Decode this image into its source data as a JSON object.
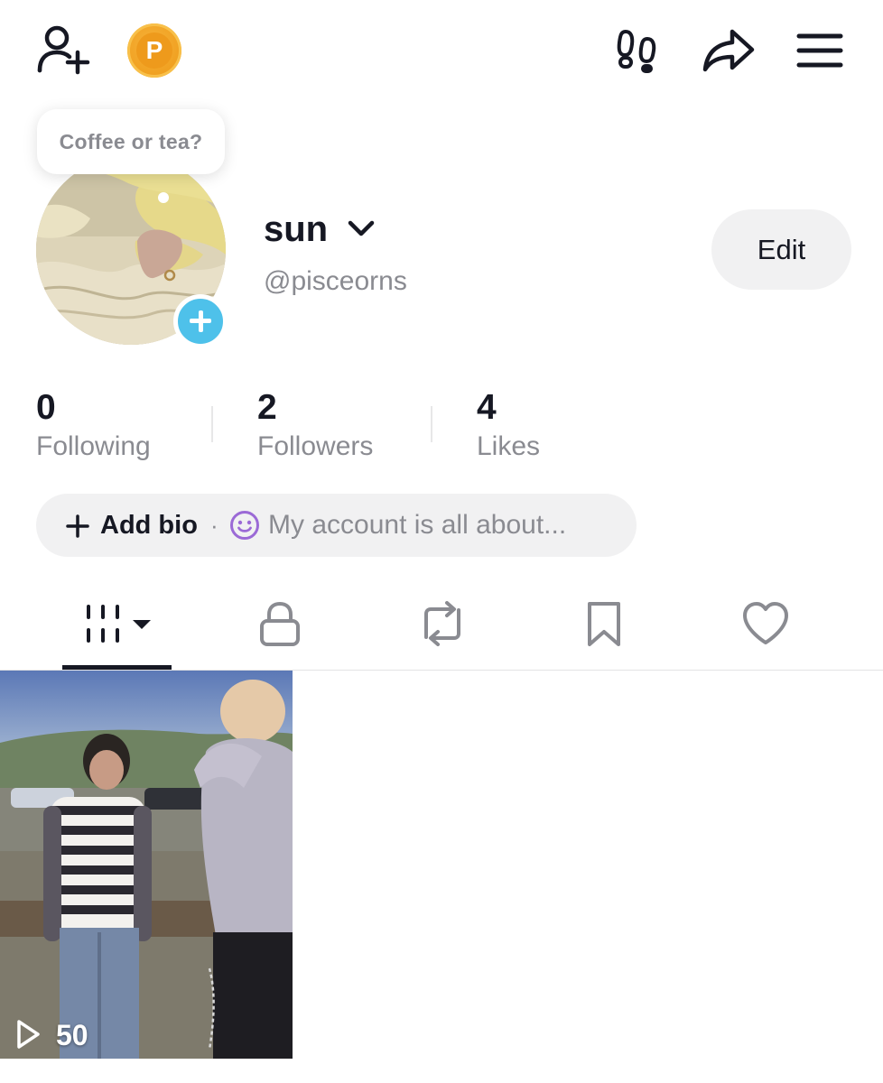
{
  "top_bar": {
    "coin_label": "P"
  },
  "profile": {
    "tooltip": "Coffee or tea?",
    "username": "sun",
    "handle": "@pisceorns",
    "edit_label": "Edit"
  },
  "stats": [
    {
      "value": "0",
      "label": "Following"
    },
    {
      "value": "2",
      "label": "Followers"
    },
    {
      "value": "4",
      "label": "Likes"
    }
  ],
  "bio": {
    "add_label": "Add bio",
    "separator": "·",
    "placeholder": "My account is all about..."
  },
  "tabs": [
    {
      "icon": "videos-grid-icon",
      "active": true
    },
    {
      "icon": "lock-icon",
      "active": false
    },
    {
      "icon": "repost-icon",
      "active": false
    },
    {
      "icon": "bookmark-icon",
      "active": false
    },
    {
      "icon": "heart-icon",
      "active": false
    }
  ],
  "videos": [
    {
      "views": "50"
    }
  ],
  "colors": {
    "text_primary": "#161823",
    "text_secondary": "#8a8b91",
    "pill_bg": "#f1f1f2",
    "avatar_add": "#4ec1ea",
    "coin": "#f0a020",
    "smile": "#9b6ad6"
  }
}
